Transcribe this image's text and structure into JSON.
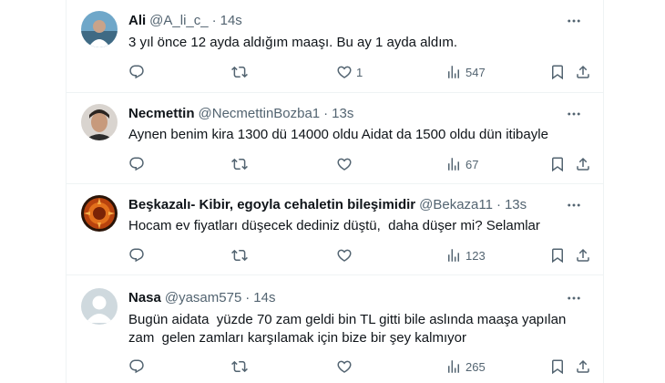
{
  "tweets": [
    {
      "name": "Ali",
      "handle": "@A_li_c_",
      "time": "14s",
      "text": "3 yıl önce 12 ayda aldığım maaşı. Bu ay 1 ayda aldım.",
      "replies": "",
      "retweets": "",
      "likes": "1",
      "views": "547"
    },
    {
      "name": "Necmettin",
      "handle": "@NecmettinBozba1",
      "time": "13s",
      "text": "Aynen benim kira 1300 dü 14000 oldu Aidat da 1500 oldu dün itibayle",
      "replies": "",
      "retweets": "",
      "likes": "",
      "views": "67"
    },
    {
      "name": "Beşkazalı- Kibir, egoyla cehaletin bileşimidir",
      "handle": "@Bekaza11",
      "time": "13s",
      "text": "Hocam ev fiyatları düşecek dediniz düştü,  daha düşer mi? Selamlar",
      "replies": "",
      "retweets": "",
      "likes": "",
      "views": "123"
    },
    {
      "name": "Nasa",
      "handle": "@yasam575",
      "time": "14s",
      "text": "Bugün aidata  yüzde 70 zam geldi bin TL gitti bile aslında maaşa yapılan\nzam  gelen zamları karşılamak için bize bir şey kalmıyor",
      "replies": "",
      "retweets": "",
      "likes": "",
      "views": "265"
    }
  ],
  "separator": "·",
  "icons": [
    "more-icon",
    "reply-icon",
    "retweet-icon",
    "like-icon",
    "views-icon",
    "bookmark-icon",
    "share-icon"
  ],
  "colors": {
    "text": "#0f1419",
    "secondary": "#536471",
    "border": "#eff3f4"
  }
}
